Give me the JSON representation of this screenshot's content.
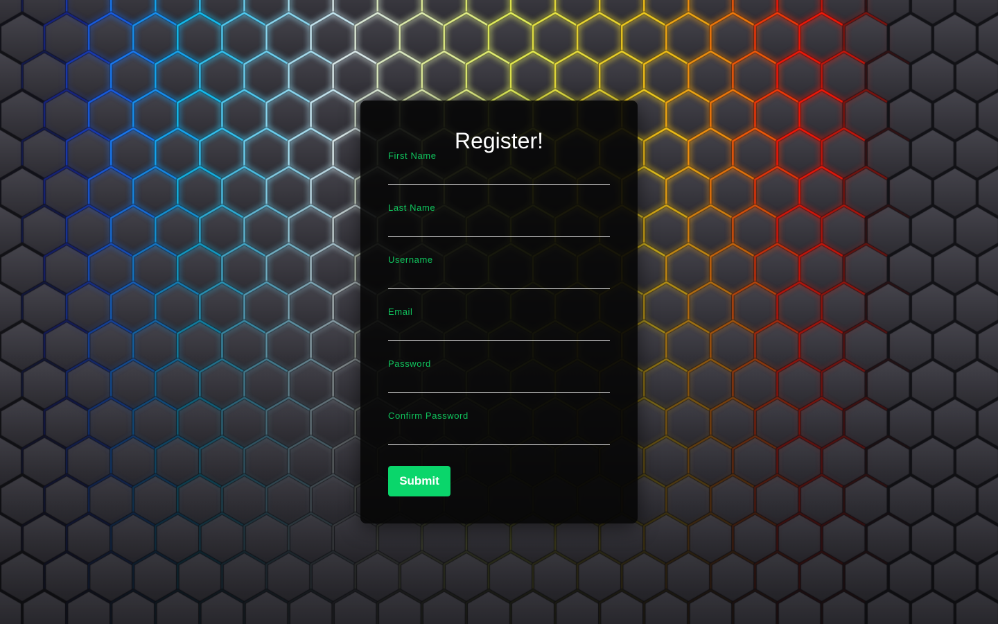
{
  "background": {
    "icon": "hexagon-pattern",
    "base_color": "#2e2d33",
    "glow_colors": [
      "#1f3cff",
      "#16c8ff",
      "#e8f8ff",
      "#f2ff5a",
      "#ffd21a",
      "#ff7a0a",
      "#ff1a0a"
    ]
  },
  "form": {
    "title": "Register!",
    "accent_color": "#0ad66b",
    "fields": [
      {
        "label": "First Name",
        "value": "",
        "type": "text"
      },
      {
        "label": "Last Name",
        "value": "",
        "type": "text"
      },
      {
        "label": "Username",
        "value": "",
        "type": "text"
      },
      {
        "label": "Email",
        "value": "",
        "type": "email"
      },
      {
        "label": "Password",
        "value": "",
        "type": "password"
      },
      {
        "label": "Confirm Password",
        "value": "",
        "type": "password"
      }
    ],
    "submit_label": "Submit"
  }
}
